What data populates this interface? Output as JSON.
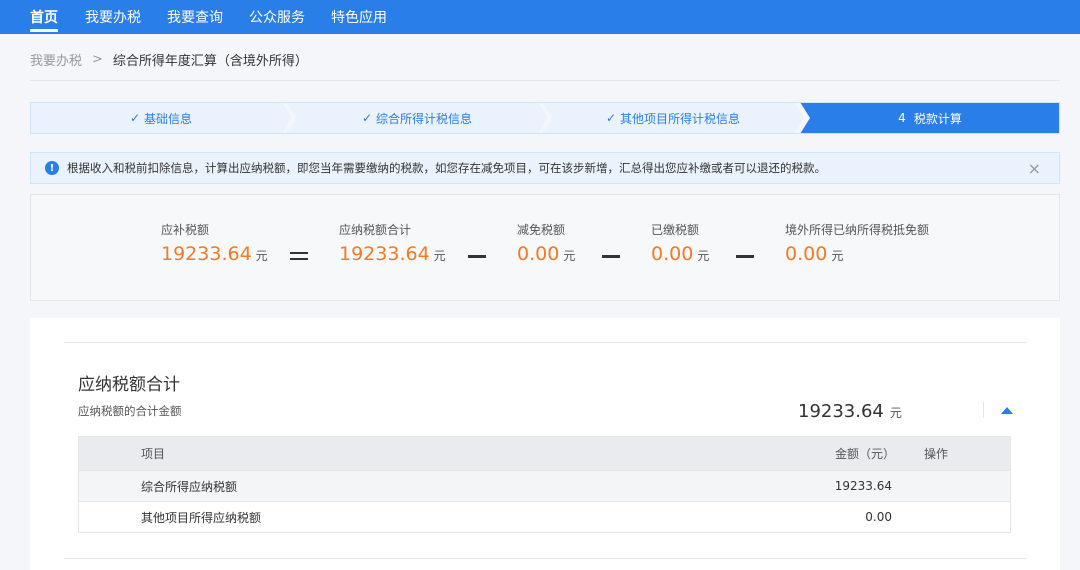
{
  "nav": {
    "items": [
      "首页",
      "我要办税",
      "我要查询",
      "公众服务",
      "特色应用"
    ]
  },
  "breadcrumb": {
    "home": "我要办税",
    "separator": ">",
    "current": "综合所得年度汇算（含境外所得）"
  },
  "steps": [
    {
      "label": "基础信息",
      "state": "done",
      "check": "✓"
    },
    {
      "label": "综合所得计税信息",
      "state": "done",
      "check": "✓"
    },
    {
      "label": "其他项目所得计税信息",
      "state": "done",
      "check": "✓"
    },
    {
      "label": "税款计算",
      "state": "active",
      "number": "4"
    }
  ],
  "banner": {
    "icon": "!",
    "text": "根据收入和税前扣除信息，计算出应纳税额，即您当年需要缴纳的税款，如您存在减免项目，可在该步新增，汇总得出您应补缴或者可以退还的税款。",
    "close": "×"
  },
  "summary": {
    "unit": "元",
    "items": [
      {
        "label": "应补税额",
        "value": "19233.64"
      },
      {
        "label": "应纳税额合计",
        "value": "19233.64"
      },
      {
        "label": "减免税额",
        "value": "0.00"
      },
      {
        "label": "已缴税额",
        "value": "0.00"
      },
      {
        "label": "境外所得已纳所得税抵免额",
        "value": "0.00"
      }
    ]
  },
  "detail": {
    "title": "应纳税额合计",
    "subtitle": "应纳税额的合计金额",
    "total": "19233.64",
    "unit": "元",
    "table": {
      "headers": {
        "item": "项目",
        "amount": "金额（元）",
        "action": "操作"
      },
      "rows": [
        {
          "item": "综合所得应纳税额",
          "amount": "19233.64"
        },
        {
          "item": "其他项目所得应纳税额",
          "amount": "0.00"
        }
      ]
    }
  },
  "colors": {
    "primary": "#2a7ee8",
    "accent": "#f47a23"
  }
}
